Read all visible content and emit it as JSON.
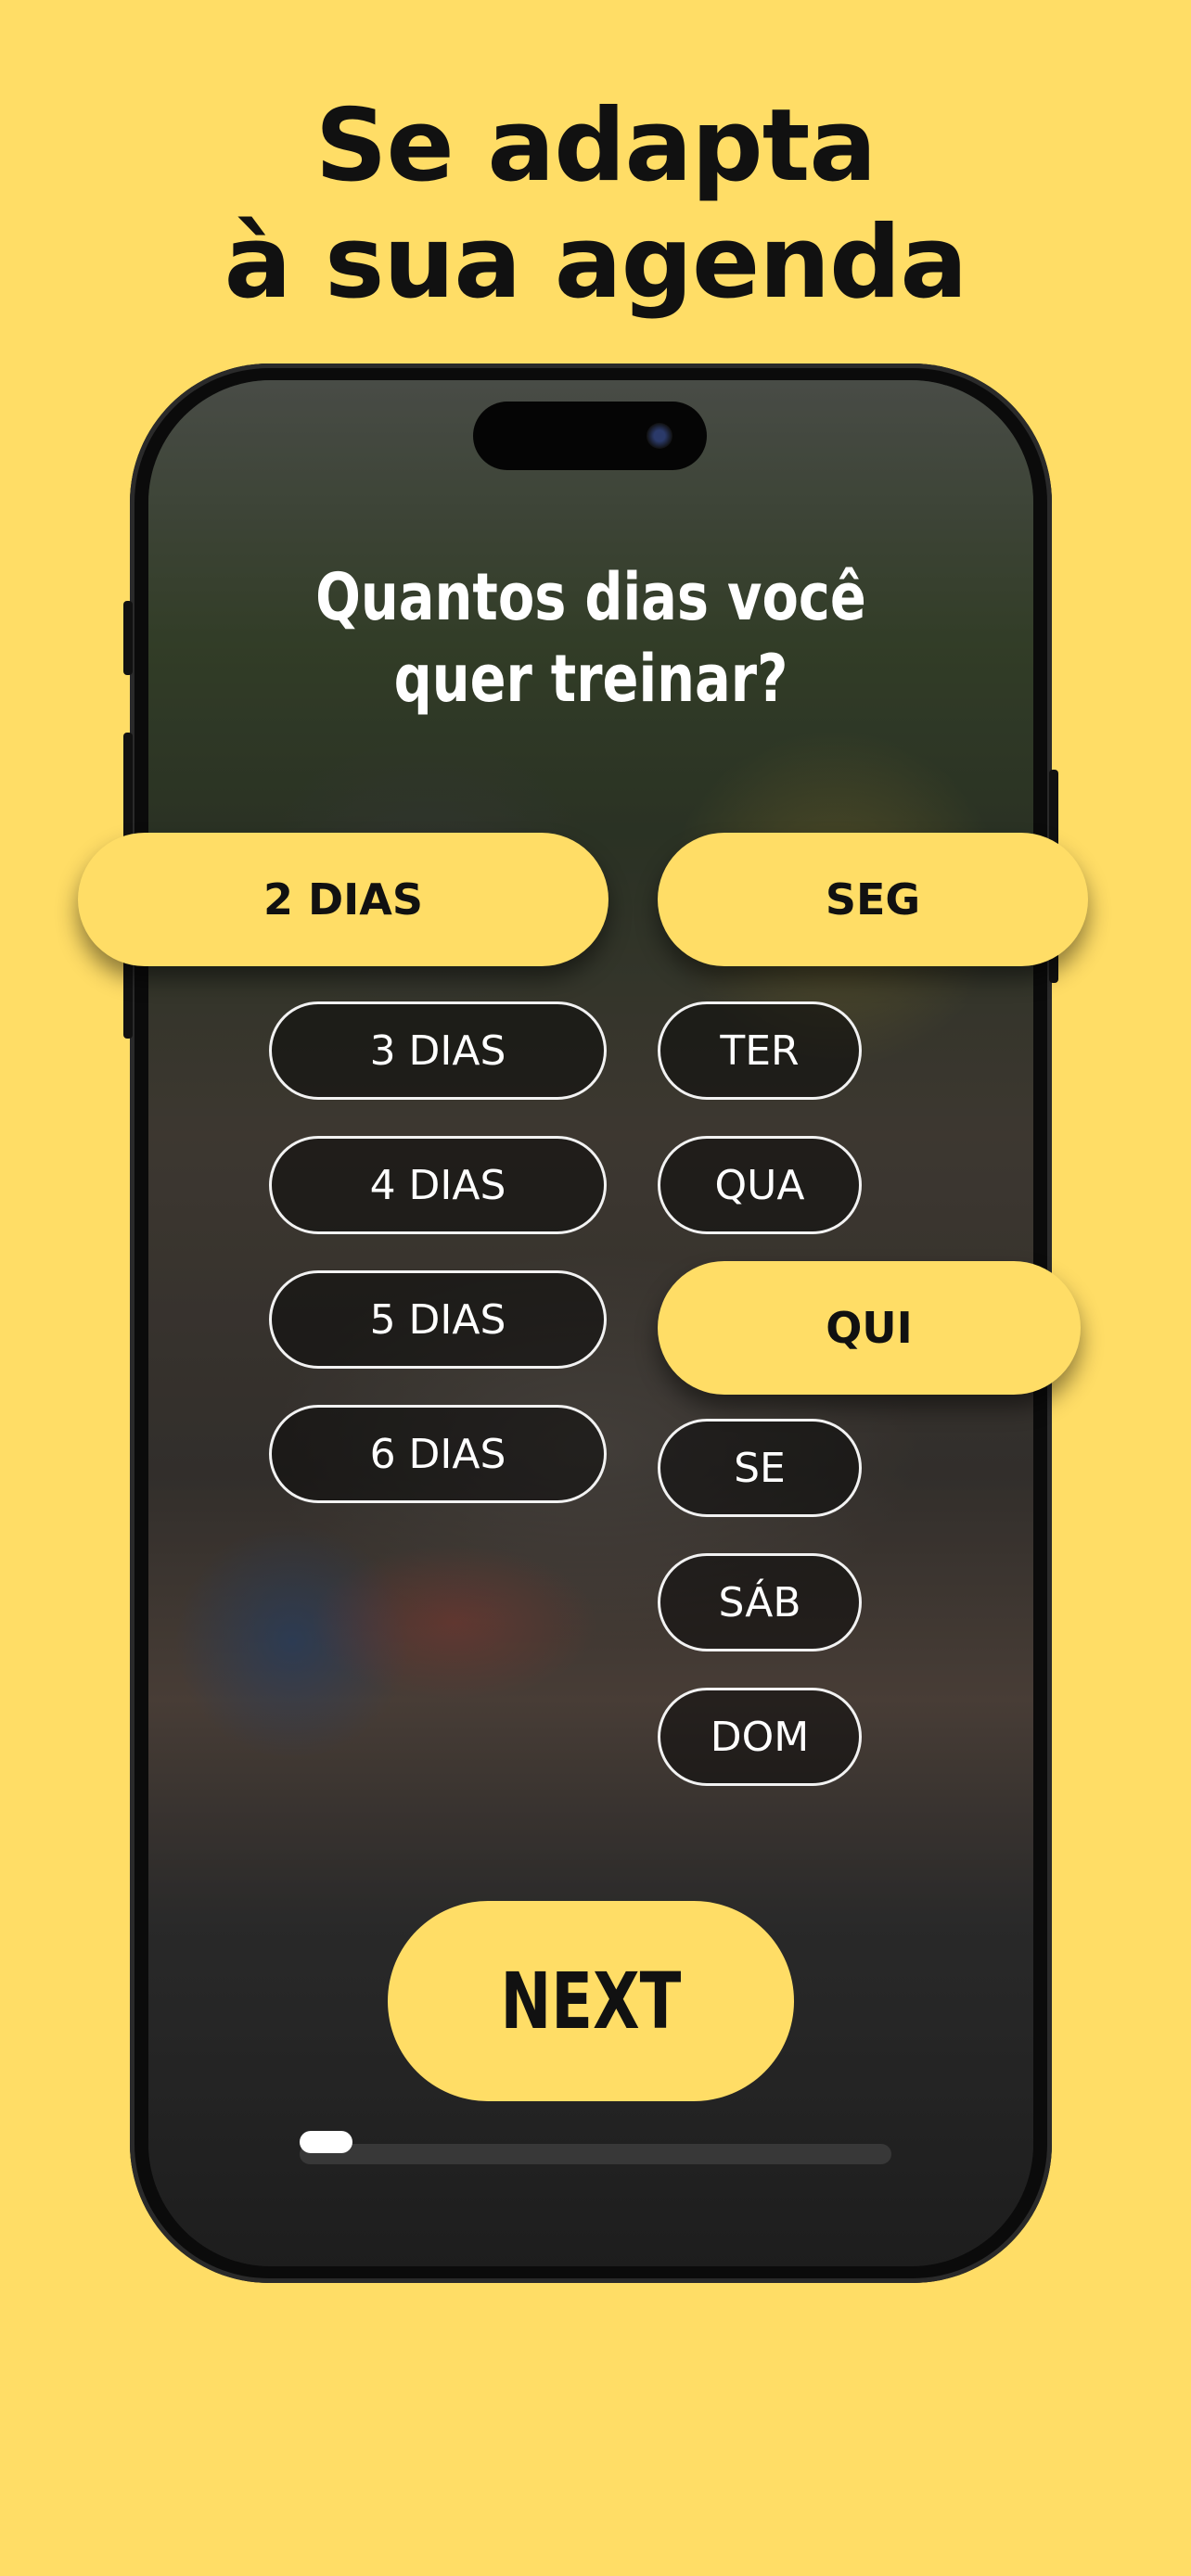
{
  "headline": {
    "line1": "Se adapta",
    "line2": "à sua agenda"
  },
  "screen": {
    "question_line1": "Quantos dias você",
    "question_line2": "quer treinar?",
    "day_counts": [
      {
        "label": "2 DIAS",
        "selected": true
      },
      {
        "label": "3 DIAS",
        "selected": false
      },
      {
        "label": "4 DIAS",
        "selected": false
      },
      {
        "label": "5 DIAS",
        "selected": false
      },
      {
        "label": "6 DIAS",
        "selected": false
      }
    ],
    "weekdays": [
      {
        "label": "SEG",
        "selected": true
      },
      {
        "label": "TER",
        "selected": false
      },
      {
        "label": "QUA",
        "selected": false
      },
      {
        "label": "QUI",
        "selected": true
      },
      {
        "label": "SE",
        "selected": false
      },
      {
        "label": "SÁB",
        "selected": false
      },
      {
        "label": "DOM",
        "selected": false
      }
    ],
    "next_label": "NEXT",
    "progress": 0.09
  },
  "colors": {
    "background": "#FFDD66",
    "accent": "#FFDD66",
    "text_dark": "#111111",
    "text_light": "#FFFFFF"
  }
}
